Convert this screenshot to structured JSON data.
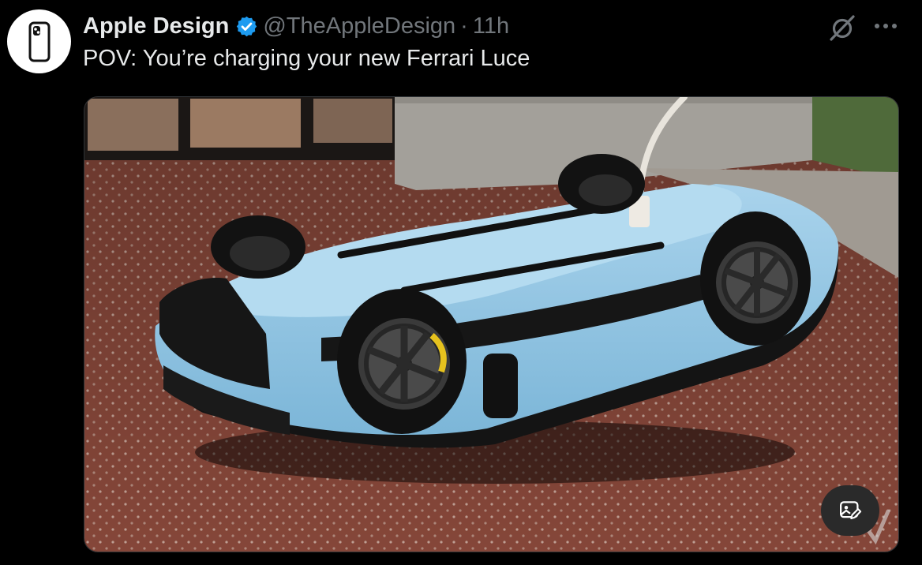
{
  "tweet": {
    "display_name": "Apple Design",
    "handle": "@TheAppleDesign",
    "separator": "·",
    "time": "11h",
    "text": "POV: You’re charging your new Ferrari Luce",
    "verified": true
  },
  "icons": {
    "avatar": "iphone-icon",
    "verified": "verified-badge-icon",
    "grok": "grok-icon",
    "more": "more-icon",
    "media_action": "image-edit-icon"
  },
  "colors": {
    "background": "#000000",
    "primary_text": "#e7e9ea",
    "secondary_text": "#71767b",
    "verified_blue": "#1d9bf0",
    "car_blue": "#8fc3e2"
  }
}
